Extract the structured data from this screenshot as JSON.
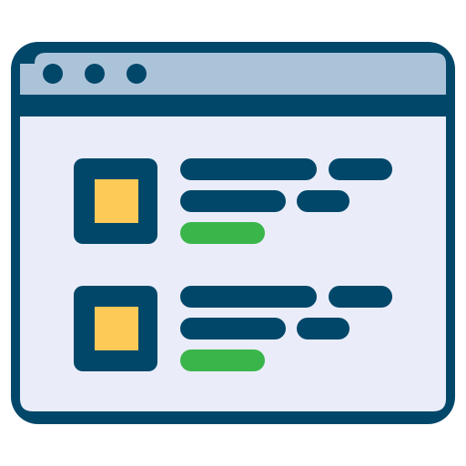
{
  "icon": {
    "name": "browser-window-list-icon",
    "colors": {
      "outline": "#00476A",
      "titlebar": "#ABC3D9",
      "content": "#EAEDF9",
      "thumbnail": "#FECA57",
      "accent": "#3AB54A"
    },
    "window_controls": [
      "dot",
      "dot",
      "dot"
    ],
    "list_items": [
      {
        "thumbnail": "yellow-square",
        "text_lines": 2,
        "tag": "green"
      },
      {
        "thumbnail": "yellow-square",
        "text_lines": 2,
        "tag": "green"
      }
    ]
  }
}
